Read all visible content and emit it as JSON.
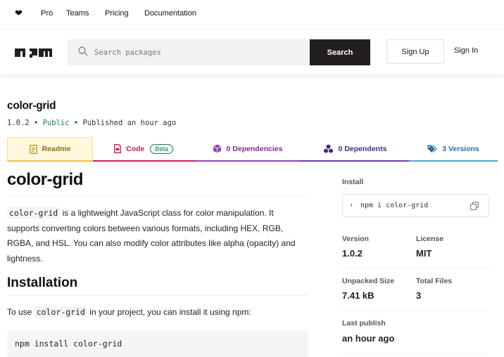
{
  "topnav": {
    "links": [
      "Pro",
      "Teams",
      "Pricing",
      "Documentation"
    ]
  },
  "header": {
    "search_placeholder": "Search packages",
    "search_button": "Search",
    "signup": "Sign Up",
    "signin": "Sign In"
  },
  "package": {
    "name": "color-grid",
    "version": "1.0.2",
    "visibility": "Public",
    "published": "Published an hour ago"
  },
  "tabs": {
    "readme": "Readme",
    "code": "Code",
    "beta": "Beta",
    "dependencies": "0 Dependencies",
    "dependents": "0 Dependents",
    "versions": "3 Versions"
  },
  "readme": {
    "title": "color-grid",
    "intro_code": "color-grid",
    "intro_text": " is a lightweight JavaScript class for color manipulation. It supports converting colors between various formats, including HEX, RGB, RGBA, and HSL. You can also modify color attributes like alpha (opacity) and lightness.",
    "install_heading": "Installation",
    "install_text_before": "To use ",
    "install_code": "color-grid",
    "install_text_after": " in your project, you can install it using npm:",
    "install_command": "npm install color-grid"
  },
  "sidebar": {
    "install_label": "Install",
    "install_command": "npm i color-grid",
    "version_label": "Version",
    "version_value": "1.0.2",
    "license_label": "License",
    "license_value": "MIT",
    "unpacked_label": "Unpacked Size",
    "unpacked_value": "7.41 kB",
    "files_label": "Total Files",
    "files_value": "3",
    "last_publish_label": "Last publish",
    "last_publish_value": "an hour ago"
  },
  "colors": {
    "readme_tab": "#8a6d12",
    "code_tab": "#c6224a",
    "deps_tab": "#8e44ad",
    "dependents_tab": "#6a3fb0",
    "versions_tab": "#2a6f9e",
    "public": "#1a7f5a"
  }
}
